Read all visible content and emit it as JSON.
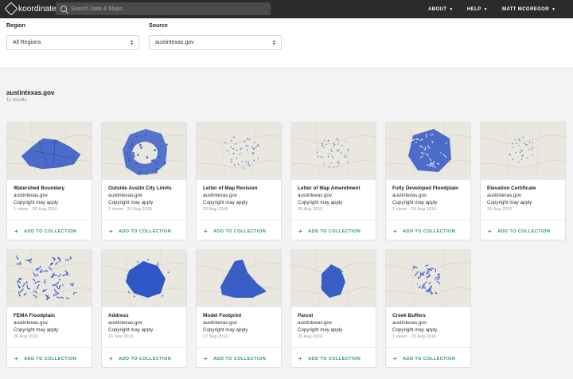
{
  "app": {
    "logo_text": "koordinates"
  },
  "search": {
    "placeholder": "Search Data & Maps..."
  },
  "nav": {
    "about": "ABOUT",
    "help": "HELP",
    "user": "MATT MCGREGOR"
  },
  "filters": {
    "region_label": "Region",
    "region_value": "All Regions",
    "source_label": "Source",
    "source_value": "austintexas.gov"
  },
  "results": {
    "title": "austintexas.gov",
    "count": "11 results"
  },
  "add_label": "ADD TO COLLECTION",
  "colors": {
    "accent": "#2e9a57",
    "layer_blue": "#2f56c4",
    "topbar": "#2b2b2b"
  },
  "cards": [
    {
      "title": "Watershed Boundary",
      "source": "austintexas.gov",
      "copyright": "Copyright may apply",
      "meta": "1 views · 26 Aug 2016"
    },
    {
      "title": "Outside Austin City Limits",
      "source": "austintexas.gov",
      "copyright": "Copyright may apply",
      "meta": "1 views · 26 Aug 2016"
    },
    {
      "title": "Letter of Map Revision",
      "source": "austintexas.gov",
      "copyright": "Copyright may apply",
      "meta": "26 Aug 2016"
    },
    {
      "title": "Letter of Map Amendment",
      "source": "austintexas.gov",
      "copyright": "Copyright may apply",
      "meta": "26 Aug 2016"
    },
    {
      "title": "Fully Developed Floodplain",
      "source": "austintexas.gov",
      "copyright": "Copyright may apply",
      "meta": "1 views · 26 Aug 2016"
    },
    {
      "title": "Elevation Certificate",
      "source": "austintexas.gov",
      "copyright": "Copyright may apply",
      "meta": "26 Aug 2016"
    },
    {
      "title": "FEMA Floodplain",
      "source": "austintexas.gov",
      "copyright": "Copyright may apply",
      "meta": "26 Aug 2016"
    },
    {
      "title": "Address",
      "source": "austintexas.gov",
      "copyright": "Copyright may apply",
      "meta": "16 Nov 2016"
    },
    {
      "title": "Model Footprint",
      "source": "austintexas.gov",
      "copyright": "Copyright may apply",
      "meta": "17 Sep 2016"
    },
    {
      "title": "Parcel",
      "source": "austintexas.gov",
      "copyright": "Copyright may apply",
      "meta": "26 Aug 2016"
    },
    {
      "title": "Creek Buffers",
      "source": "austintexas.gov",
      "copyright": "Copyright may apply",
      "meta": "1 views · 26 Aug 2016"
    }
  ]
}
